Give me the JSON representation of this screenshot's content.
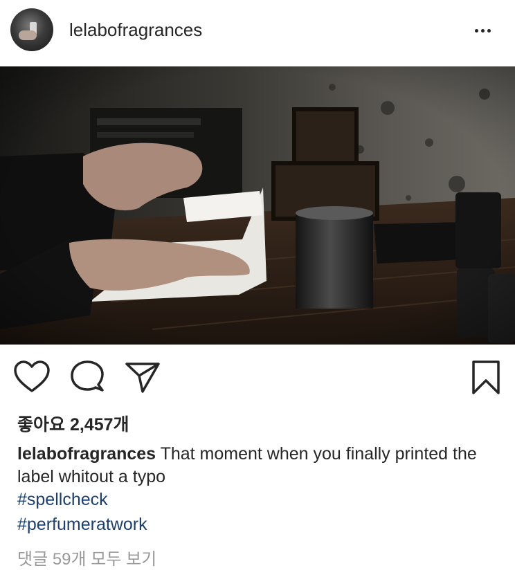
{
  "header": {
    "username": "lelabofragrances",
    "more_icon": "more-horizontal-icon"
  },
  "post": {
    "image_alt": "hands peeling a SANTAL 33 label on a dark wooden table"
  },
  "actions": {
    "like_icon": "heart-icon",
    "comment_icon": "comment-icon",
    "share_icon": "paper-plane-icon",
    "save_icon": "bookmark-icon"
  },
  "likes": {
    "text": "좋아요 2,457개"
  },
  "caption": {
    "username": "lelabofragrances",
    "text": " That moment when you finally printed the label whitout a typo"
  },
  "hashtags": [
    "#spellcheck",
    "#perfumeratwork"
  ],
  "comments_link": "댓글 59개 모두 보기"
}
